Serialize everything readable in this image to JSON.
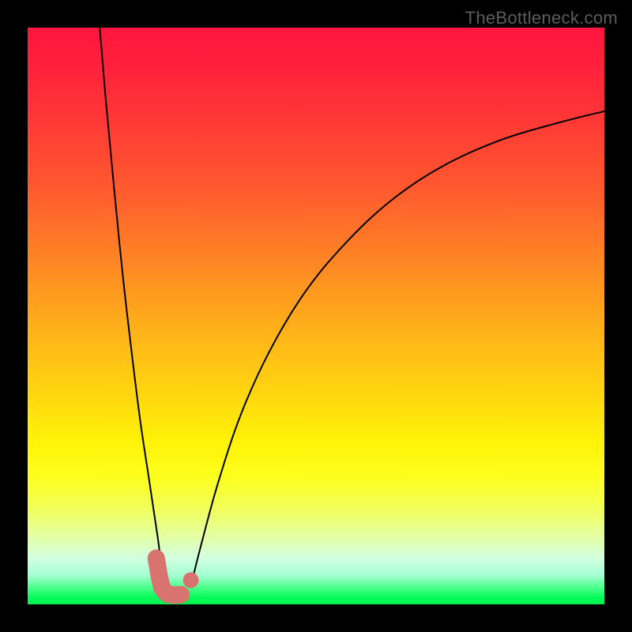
{
  "watermark": {
    "text": "TheBottleneck.com"
  },
  "chart_data": {
    "type": "line",
    "title": "",
    "xlabel": "",
    "ylabel": "",
    "xlim": [
      0,
      100
    ],
    "ylim": [
      0,
      100
    ],
    "grid": false,
    "legend": false,
    "background_gradient": {
      "direction": "vertical",
      "stops": [
        {
          "pos": 0,
          "color": "#ff163f"
        },
        {
          "pos": 50,
          "color": "#ffc015"
        },
        {
          "pos": 78,
          "color": "#fdff1f"
        },
        {
          "pos": 100,
          "color": "#00f050"
        }
      ]
    },
    "series": [
      {
        "name": "left-curve",
        "color": "#000000",
        "x": [
          12.5,
          13.5,
          15.0,
          16.5,
          18.0,
          19.5,
          21.0,
          22.5,
          23.3,
          23.8,
          24.3
        ],
        "y": [
          100.0,
          88.0,
          72.0,
          57.0,
          44.0,
          32.0,
          22.0,
          12.0,
          6.0,
          3.0,
          1.0
        ]
      },
      {
        "name": "right-curve",
        "color": "#000000",
        "x": [
          28.5,
          30.0,
          33.0,
          37.0,
          42.0,
          48.0,
          55.0,
          63.0,
          72.0,
          82.0,
          92.0,
          100.0
        ],
        "y": [
          4.0,
          10.0,
          21.0,
          33.0,
          44.0,
          54.0,
          62.5,
          70.0,
          76.0,
          80.5,
          83.5,
          85.5
        ]
      }
    ],
    "markers": [
      {
        "name": "lower-L-marker",
        "color": "#d9736f",
        "shape": "L",
        "points": [
          {
            "x": 22.3,
            "y": 8.0
          },
          {
            "x": 22.8,
            "y": 5.0
          },
          {
            "x": 23.3,
            "y": 2.8
          },
          {
            "x": 24.2,
            "y": 1.8
          },
          {
            "x": 25.4,
            "y": 1.6
          },
          {
            "x": 26.6,
            "y": 1.7
          }
        ],
        "stroke_width": 22,
        "cap": "round"
      },
      {
        "name": "right-dot-marker",
        "color": "#d9736f",
        "shape": "dot",
        "cx": 28.3,
        "cy": 4.2,
        "r": 10
      }
    ]
  }
}
